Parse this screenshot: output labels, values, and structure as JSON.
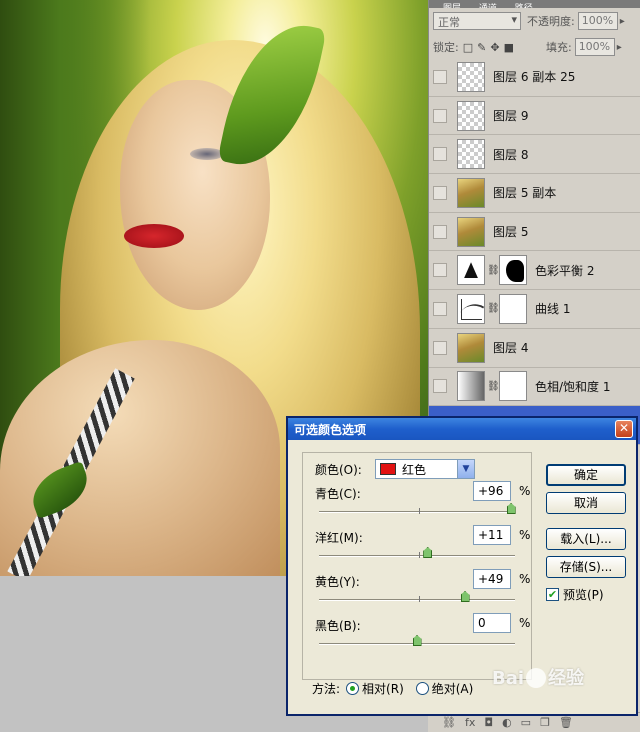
{
  "layers_panel": {
    "tabs": [
      "图层",
      "通道",
      "路径"
    ],
    "blend_mode": "正常",
    "opacity_label": "不透明度:",
    "opacity_value": "100%",
    "lock_label": "锁定:",
    "fill_label": "填充:",
    "fill_value": "100%",
    "layers": [
      {
        "name": "图层 6 副本 25",
        "thumb": "transparent"
      },
      {
        "name": "图层 9",
        "thumb": "transparent"
      },
      {
        "name": "图层 8",
        "thumb": "transparent"
      },
      {
        "name": "图层 5 副本",
        "thumb": "photo"
      },
      {
        "name": "图层 5",
        "thumb": "photo"
      },
      {
        "name": "色彩平衡 2",
        "thumb": "color-balance",
        "mask": "shape"
      },
      {
        "name": "曲线 1",
        "thumb": "curves",
        "mask": "white"
      },
      {
        "name": "图层 4",
        "thumb": "photo"
      },
      {
        "name": "色相/饱和度 1",
        "thumb": "hue-saturation",
        "mask": "white"
      },
      {
        "name": "",
        "thumb": "selected"
      }
    ],
    "footer_icons": [
      "link-icon",
      "fx-icon",
      "mask-icon",
      "adjustment-icon",
      "folder-icon",
      "new-layer-icon",
      "trash-icon"
    ]
  },
  "dialog": {
    "title": "可选颜色选项",
    "colors_label": "颜色(O):",
    "colors_selected": "红色",
    "swatch_color": "#e21212",
    "sliders": [
      {
        "label": "青色(C):",
        "value": "+96",
        "level_percent": 96
      },
      {
        "label": "洋红(M):",
        "value": "+11",
        "level_percent": 11
      },
      {
        "label": "黄色(Y):",
        "value": "+49",
        "level_percent": 49
      },
      {
        "label": "黑色(B):",
        "value": "0",
        "level_percent": 0
      }
    ],
    "percent_sign": "%",
    "buttons": {
      "ok": "确定",
      "cancel": "取消",
      "load": "载入(L)...",
      "save": "存储(S)..."
    },
    "preview_label": "预览(P)",
    "preview_checked": true,
    "method_label": "方法:",
    "method_relative": "相对(R)",
    "method_absolute": "绝对(A)",
    "method_selected": "relative"
  },
  "watermark": {
    "text_left": "Bai",
    "text_right": "经验"
  }
}
